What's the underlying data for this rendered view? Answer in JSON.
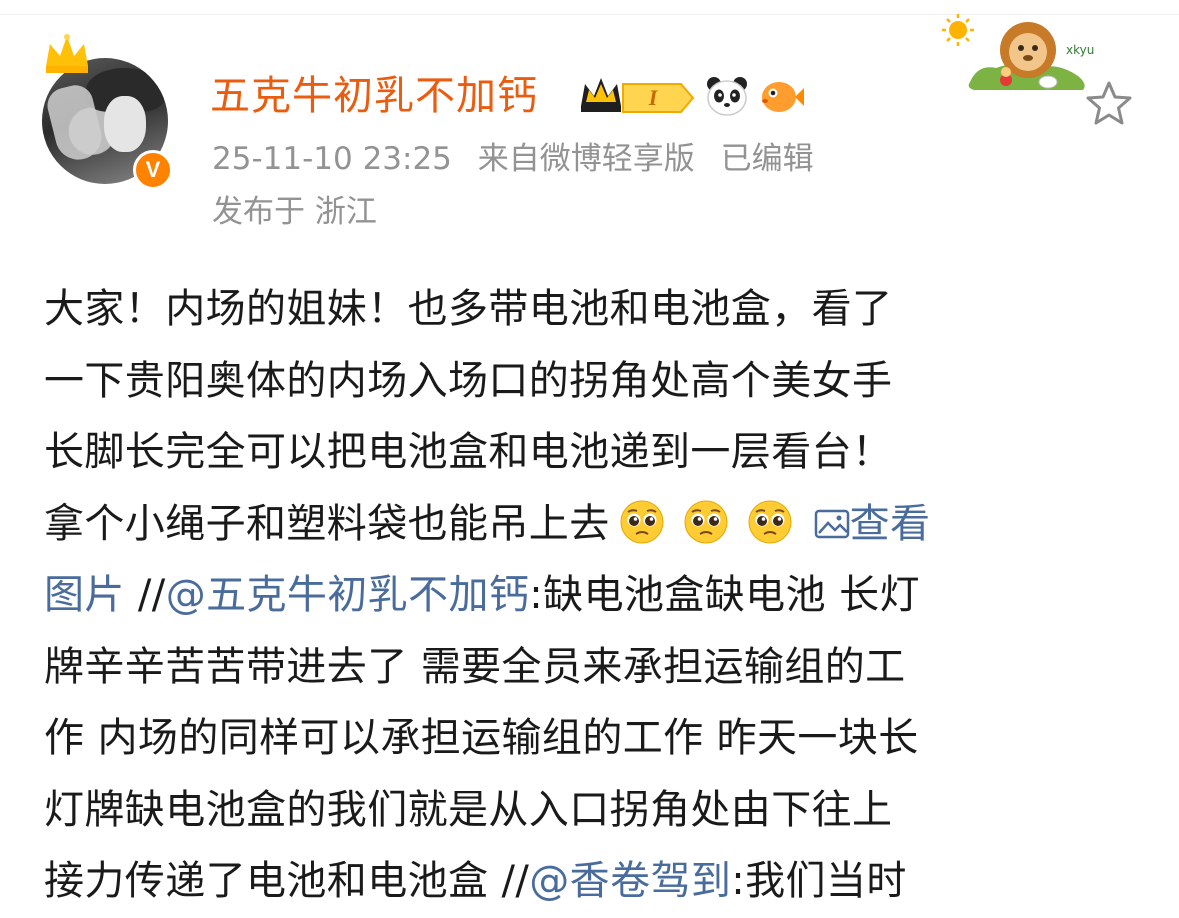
{
  "post": {
    "author": {
      "name": "五克牛初乳不加钙",
      "avatar": "avatar",
      "verified_badge": "V",
      "level_badge": "I",
      "badge_icons": [
        "crown-level-icon",
        "panda-icon",
        "puffer-fish-icon"
      ]
    },
    "meta": {
      "datetime": "25-11-10 23:25",
      "source": "来自微博轻享版",
      "edited": "已编辑",
      "location": "发布于 浙江"
    },
    "body": {
      "line1": "大家！内场的姐妹！也多带电池和电池盒，看了",
      "line2": "一下贵阳奥体的内场入场口的拐角处高个美女手",
      "line3": "长脚长完全可以把电池盒和电池递到一层看台！",
      "line4_text": "拿个小绳子和塑料袋也能吊上去",
      "line4_link": "查看",
      "line5_link": "图片",
      "line5_sep": " //",
      "line5_mention": "@五克牛初乳不加钙",
      "line5_text": ":缺电池盒缺电池 长灯",
      "line6": "牌辛辛苦苦带进去了 需要全员来承担运输组的工",
      "line7": "作 内场的同样可以承担运输组的工作 昨天一块长",
      "line8": "灯牌缺电池盒的我们就是从入口拐角处由下往上",
      "line9_text": "接力传递了电池和电池盒 ",
      "line9_sep": "//",
      "line9_mention": "@香卷驾到",
      "line9_text2": ":我们当时"
    },
    "icons": [
      "pleading-face-emoji",
      "image-icon",
      "star-icon",
      "sun-icon",
      "lion-sticker"
    ],
    "colors": {
      "username": "#ea5d10",
      "link": "#4a6c9c",
      "meta": "#939393",
      "verified": "#ff8200"
    }
  }
}
